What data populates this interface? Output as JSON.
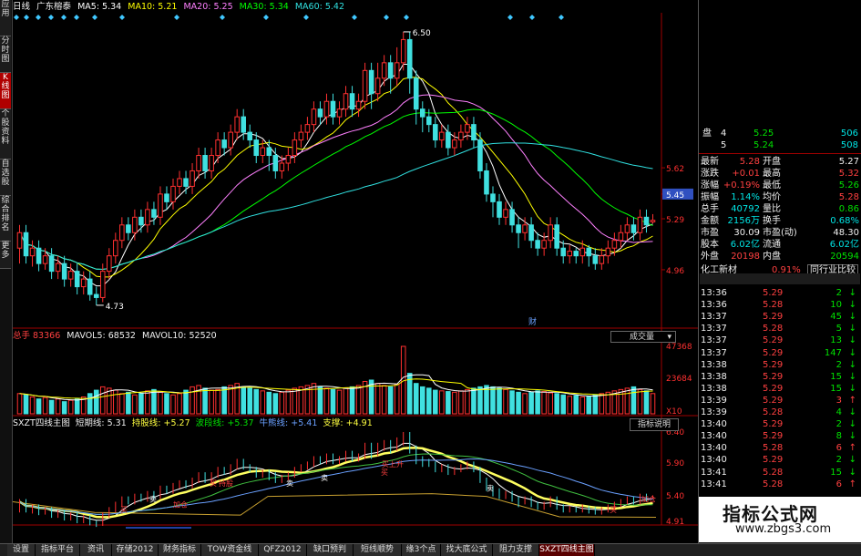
{
  "left_tabs": [
    {
      "label": "应用",
      "active": false
    },
    {
      "label": "分时图",
      "active": false
    },
    {
      "label": "K线图",
      "active": true
    },
    {
      "label": "个股资料",
      "active": false
    },
    {
      "label": "自选股",
      "active": false
    },
    {
      "label": "综合排名",
      "active": false
    },
    {
      "label": "更多",
      "active": false
    }
  ],
  "header": {
    "period": "日线",
    "stock": "广东榕泰",
    "ma5": "MA5: 5.34",
    "ma10": "MA10: 5.21",
    "ma20": "MA20: 5.25",
    "ma30": "MA30: 5.34",
    "ma60": "MA60: 5.42",
    "colors": {
      "ma5": "#ffffff",
      "ma10": "#ffff00",
      "ma20": "#ff80ff",
      "ma30": "#00ff00",
      "ma60": "#30e0e0"
    }
  },
  "price_axis": {
    "labels": [
      "5.62",
      "5.45",
      "5.29",
      "4.96"
    ],
    "current": "5.45"
  },
  "annotations": {
    "high": "6.50",
    "low": "4.73",
    "fin": "财"
  },
  "volume_panel": {
    "title": "总手",
    "total": "83366",
    "mavol5": "MAVOL5: 68532",
    "mavol10": "MAVOL10: 52520",
    "selector": "成交量",
    "axis": [
      "47368",
      "23684",
      "X10"
    ]
  },
  "indicator_panel": {
    "title": "SXZT四线主图",
    "l1": "短期线: 5.31",
    "l2": "持股线: +5.27",
    "l3": "波段线: +5.37",
    "l4": "牛熊线: +5.41",
    "l5": "支撑: +4.91",
    "button": "指标说明",
    "axis": [
      "6.40",
      "5.90",
      "5.40",
      "4.91"
    ],
    "signals": [
      "买",
      "加仓",
      "卖",
      "卖",
      "买",
      "持股",
      "卖",
      "买",
      "买上升",
      "卖",
      "买",
      "加仓"
    ]
  },
  "x_axis": [
    "11",
    "12",
    "2012-12-14/五",
    "02",
    "03",
    "04",
    "05"
  ],
  "quote": {
    "order_book": [
      [
        "盘",
        "4",
        "5.25",
        "506"
      ],
      [
        "",
        "5",
        "5.24",
        "508"
      ]
    ],
    "stats": [
      [
        "最新",
        "5.28",
        "开盘",
        "5.27"
      ],
      [
        "涨跌",
        "+0.01",
        "最高",
        "5.32"
      ],
      [
        "涨幅",
        "+0.19%",
        "最低",
        "5.26"
      ],
      [
        "振幅",
        "1.14%",
        "均价",
        "5.28"
      ],
      [
        "总手",
        "40792",
        "量比",
        "0.86"
      ],
      [
        "金额",
        "2156万",
        "换手",
        "0.68%"
      ],
      [
        "市盈",
        "30.09",
        "市盈(动)",
        "48.30"
      ],
      [
        "股本",
        "6.02亿",
        "流通",
        "6.02亿"
      ],
      [
        "外盘",
        "20198",
        "内盘",
        "20594"
      ]
    ],
    "industry": {
      "name": "化工新材",
      "pct": "0.91%",
      "link": "同行业比较"
    }
  },
  "ticks": [
    [
      "13:36",
      "5.29",
      "2",
      "down"
    ],
    [
      "13:36",
      "5.28",
      "10",
      "down"
    ],
    [
      "13:37",
      "5.29",
      "45",
      "down"
    ],
    [
      "13:37",
      "5.28",
      "5",
      "down"
    ],
    [
      "13:37",
      "5.29",
      "13",
      "down"
    ],
    [
      "13:37",
      "5.29",
      "147",
      "down"
    ],
    [
      "13:38",
      "5.29",
      "2",
      "down"
    ],
    [
      "13:38",
      "5.29",
      "15",
      "down"
    ],
    [
      "13:38",
      "5.29",
      "15",
      "down"
    ],
    [
      "13:39",
      "5.29",
      "3",
      "up"
    ],
    [
      "13:39",
      "5.28",
      "4",
      "down"
    ],
    [
      "13:40",
      "5.29",
      "2",
      "down"
    ],
    [
      "13:40",
      "5.29",
      "8",
      "down"
    ],
    [
      "13:40",
      "5.28",
      "6",
      "up"
    ],
    [
      "13:40",
      "5.29",
      "2",
      "down"
    ],
    [
      "13:41",
      "5.28",
      "15",
      "down"
    ],
    [
      "13:41",
      "5.28",
      "6",
      "up"
    ]
  ],
  "bottom_tabs": [
    "设置",
    "指标平台",
    "资讯",
    "存储2012",
    "财务指标",
    "TOW资金线",
    "QFZ2012",
    "缺口预判",
    "短线顺势",
    "缘3个点",
    "找大底公式",
    "阻力支撑",
    "SXZT四线主图"
  ],
  "active_bottom": "SXZT四线主图",
  "watermark": {
    "title": "指标公式网",
    "url": "www.zbgs3.com"
  },
  "chart_data": {
    "type": "candlestick",
    "candles": [
      [
        5.1,
        5.2,
        5.0,
        5.25
      ],
      [
        5.2,
        5.05,
        5.0,
        5.25
      ],
      [
        5.05,
        5.1,
        4.98,
        5.15
      ],
      [
        5.1,
        5.0,
        4.95,
        5.15
      ],
      [
        5.0,
        5.05,
        4.96,
        5.1
      ],
      [
        5.05,
        4.95,
        4.9,
        5.1
      ],
      [
        4.95,
        5.0,
        4.9,
        5.05
      ],
      [
        5.0,
        4.9,
        4.85,
        5.05
      ],
      [
        4.9,
        4.95,
        4.85,
        5.0
      ],
      [
        4.95,
        4.85,
        4.8,
        5.0
      ],
      [
        4.85,
        4.9,
        4.8,
        4.95
      ],
      [
        4.9,
        4.8,
        4.76,
        4.95
      ],
      [
        4.8,
        4.78,
        4.73,
        4.85
      ],
      [
        4.78,
        4.95,
        4.75,
        5.0
      ],
      [
        4.95,
        5.05,
        4.9,
        5.1
      ],
      [
        5.05,
        5.15,
        5.0,
        5.2
      ],
      [
        5.15,
        5.25,
        5.1,
        5.3
      ],
      [
        5.25,
        5.2,
        5.15,
        5.3
      ],
      [
        5.2,
        5.3,
        5.15,
        5.35
      ],
      [
        5.3,
        5.25,
        5.2,
        5.35
      ],
      [
        5.25,
        5.35,
        5.2,
        5.4
      ],
      [
        5.35,
        5.3,
        5.25,
        5.4
      ],
      [
        5.3,
        5.45,
        5.25,
        5.5
      ],
      [
        5.45,
        5.4,
        5.35,
        5.5
      ],
      [
        5.4,
        5.5,
        5.35,
        5.55
      ],
      [
        5.5,
        5.55,
        5.45,
        5.6
      ],
      [
        5.55,
        5.5,
        5.45,
        5.6
      ],
      [
        5.5,
        5.6,
        5.45,
        5.65
      ],
      [
        5.6,
        5.7,
        5.55,
        5.75
      ],
      [
        5.7,
        5.6,
        5.55,
        5.75
      ],
      [
        5.6,
        5.7,
        5.55,
        5.75
      ],
      [
        5.7,
        5.8,
        5.65,
        5.85
      ],
      [
        5.8,
        5.75,
        5.7,
        5.85
      ],
      [
        5.75,
        5.85,
        5.7,
        5.9
      ],
      [
        5.85,
        5.95,
        5.8,
        6.0
      ],
      [
        5.95,
        5.85,
        5.8,
        6.0
      ],
      [
        5.85,
        5.8,
        5.75,
        5.9
      ],
      [
        5.8,
        5.7,
        5.65,
        5.85
      ],
      [
        5.7,
        5.75,
        5.65,
        5.8
      ],
      [
        5.75,
        5.7,
        5.6,
        5.8
      ],
      [
        5.7,
        5.6,
        5.55,
        5.75
      ],
      [
        5.6,
        5.65,
        5.55,
        5.7
      ],
      [
        5.65,
        5.7,
        5.6,
        5.75
      ],
      [
        5.7,
        5.8,
        5.65,
        5.85
      ],
      [
        5.8,
        5.85,
        5.75,
        5.9
      ],
      [
        5.85,
        5.9,
        5.8,
        5.95
      ],
      [
        5.9,
        6.0,
        5.85,
        6.05
      ],
      [
        6.0,
        5.95,
        5.9,
        6.05
      ],
      [
        5.95,
        6.05,
        5.9,
        6.1
      ],
      [
        6.05,
        5.95,
        5.9,
        6.1
      ],
      [
        5.95,
        6.0,
        5.9,
        6.05
      ],
      [
        6.0,
        6.1,
        5.95,
        6.15
      ],
      [
        6.1,
        6.0,
        5.95,
        6.15
      ],
      [
        6.0,
        6.05,
        5.95,
        6.1
      ],
      [
        6.05,
        6.25,
        6.0,
        6.3
      ],
      [
        6.25,
        6.1,
        6.0,
        6.3
      ],
      [
        6.1,
        6.2,
        6.05,
        6.3
      ],
      [
        6.2,
        6.3,
        6.15,
        6.35
      ],
      [
        6.3,
        6.2,
        6.1,
        6.35
      ],
      [
        6.2,
        6.3,
        6.15,
        6.4
      ],
      [
        6.3,
        6.45,
        6.25,
        6.5
      ],
      [
        6.45,
        6.2,
        6.1,
        6.5
      ],
      [
        6.2,
        6.0,
        5.9,
        6.25
      ],
      [
        6.0,
        5.95,
        5.85,
        6.05
      ],
      [
        5.95,
        5.9,
        5.85,
        6.0
      ],
      [
        5.9,
        5.8,
        5.75,
        5.95
      ],
      [
        5.8,
        5.85,
        5.75,
        5.9
      ],
      [
        5.85,
        5.75,
        5.7,
        5.9
      ],
      [
        5.75,
        5.8,
        5.7,
        5.85
      ],
      [
        5.8,
        5.85,
        5.75,
        5.9
      ],
      [
        5.85,
        5.9,
        5.8,
        5.95
      ],
      [
        5.9,
        5.8,
        5.75,
        5.95
      ],
      [
        5.8,
        5.6,
        5.55,
        5.85
      ],
      [
        5.6,
        5.45,
        5.4,
        5.65
      ],
      [
        5.45,
        5.4,
        5.3,
        5.5
      ],
      [
        5.4,
        5.3,
        5.25,
        5.45
      ],
      [
        5.3,
        5.35,
        5.25,
        5.4
      ],
      [
        5.35,
        5.25,
        5.2,
        5.4
      ],
      [
        5.25,
        5.2,
        5.1,
        5.3
      ],
      [
        5.2,
        5.25,
        5.15,
        5.3
      ],
      [
        5.25,
        5.15,
        5.1,
        5.3
      ],
      [
        5.15,
        5.1,
        5.05,
        5.2
      ],
      [
        5.1,
        5.15,
        5.05,
        5.2
      ],
      [
        5.15,
        5.25,
        5.1,
        5.3
      ],
      [
        5.25,
        5.1,
        5.05,
        5.3
      ],
      [
        5.1,
        5.05,
        5.0,
        5.15
      ],
      [
        5.05,
        5.08,
        5.0,
        5.12
      ],
      [
        5.08,
        5.05,
        5.0,
        5.1
      ],
      [
        5.05,
        5.1,
        5.0,
        5.15
      ],
      [
        5.1,
        5.05,
        4.98,
        5.12
      ],
      [
        5.05,
        5.0,
        4.96,
        5.1
      ],
      [
        5.0,
        5.05,
        4.96,
        5.1
      ],
      [
        5.05,
        5.1,
        5.0,
        5.15
      ],
      [
        5.1,
        5.15,
        5.05,
        5.2
      ],
      [
        5.15,
        5.2,
        5.1,
        5.25
      ],
      [
        5.2,
        5.25,
        5.15,
        5.3
      ],
      [
        5.25,
        5.2,
        5.15,
        5.3
      ],
      [
        5.2,
        5.3,
        5.15,
        5.35
      ],
      [
        5.3,
        5.25,
        5.2,
        5.35
      ],
      [
        5.27,
        5.28,
        5.26,
        5.32
      ]
    ],
    "ylim": [
      4.7,
      6.6
    ],
    "volume": [
      30,
      28,
      25,
      22,
      24,
      20,
      22,
      18,
      20,
      22,
      25,
      30,
      35,
      40,
      38,
      35,
      30,
      32,
      28,
      30,
      34,
      36,
      32,
      30,
      28,
      30,
      35,
      40,
      42,
      38,
      35,
      36,
      40,
      42,
      45,
      40,
      38,
      36,
      34,
      32,
      30,
      32,
      35,
      38,
      40,
      42,
      45,
      40,
      38,
      36,
      35,
      38,
      40,
      42,
      48,
      50,
      45,
      42,
      40,
      44,
      100,
      60,
      45,
      40,
      38,
      35,
      34,
      33,
      32,
      34,
      36,
      38,
      40,
      42,
      40,
      38,
      36,
      34,
      32,
      30,
      32,
      34,
      33,
      31,
      30,
      28,
      26,
      27,
      25,
      26,
      28,
      30,
      32,
      34,
      36,
      38,
      40,
      36,
      34,
      30
    ],
    "volume_max": 100
  }
}
